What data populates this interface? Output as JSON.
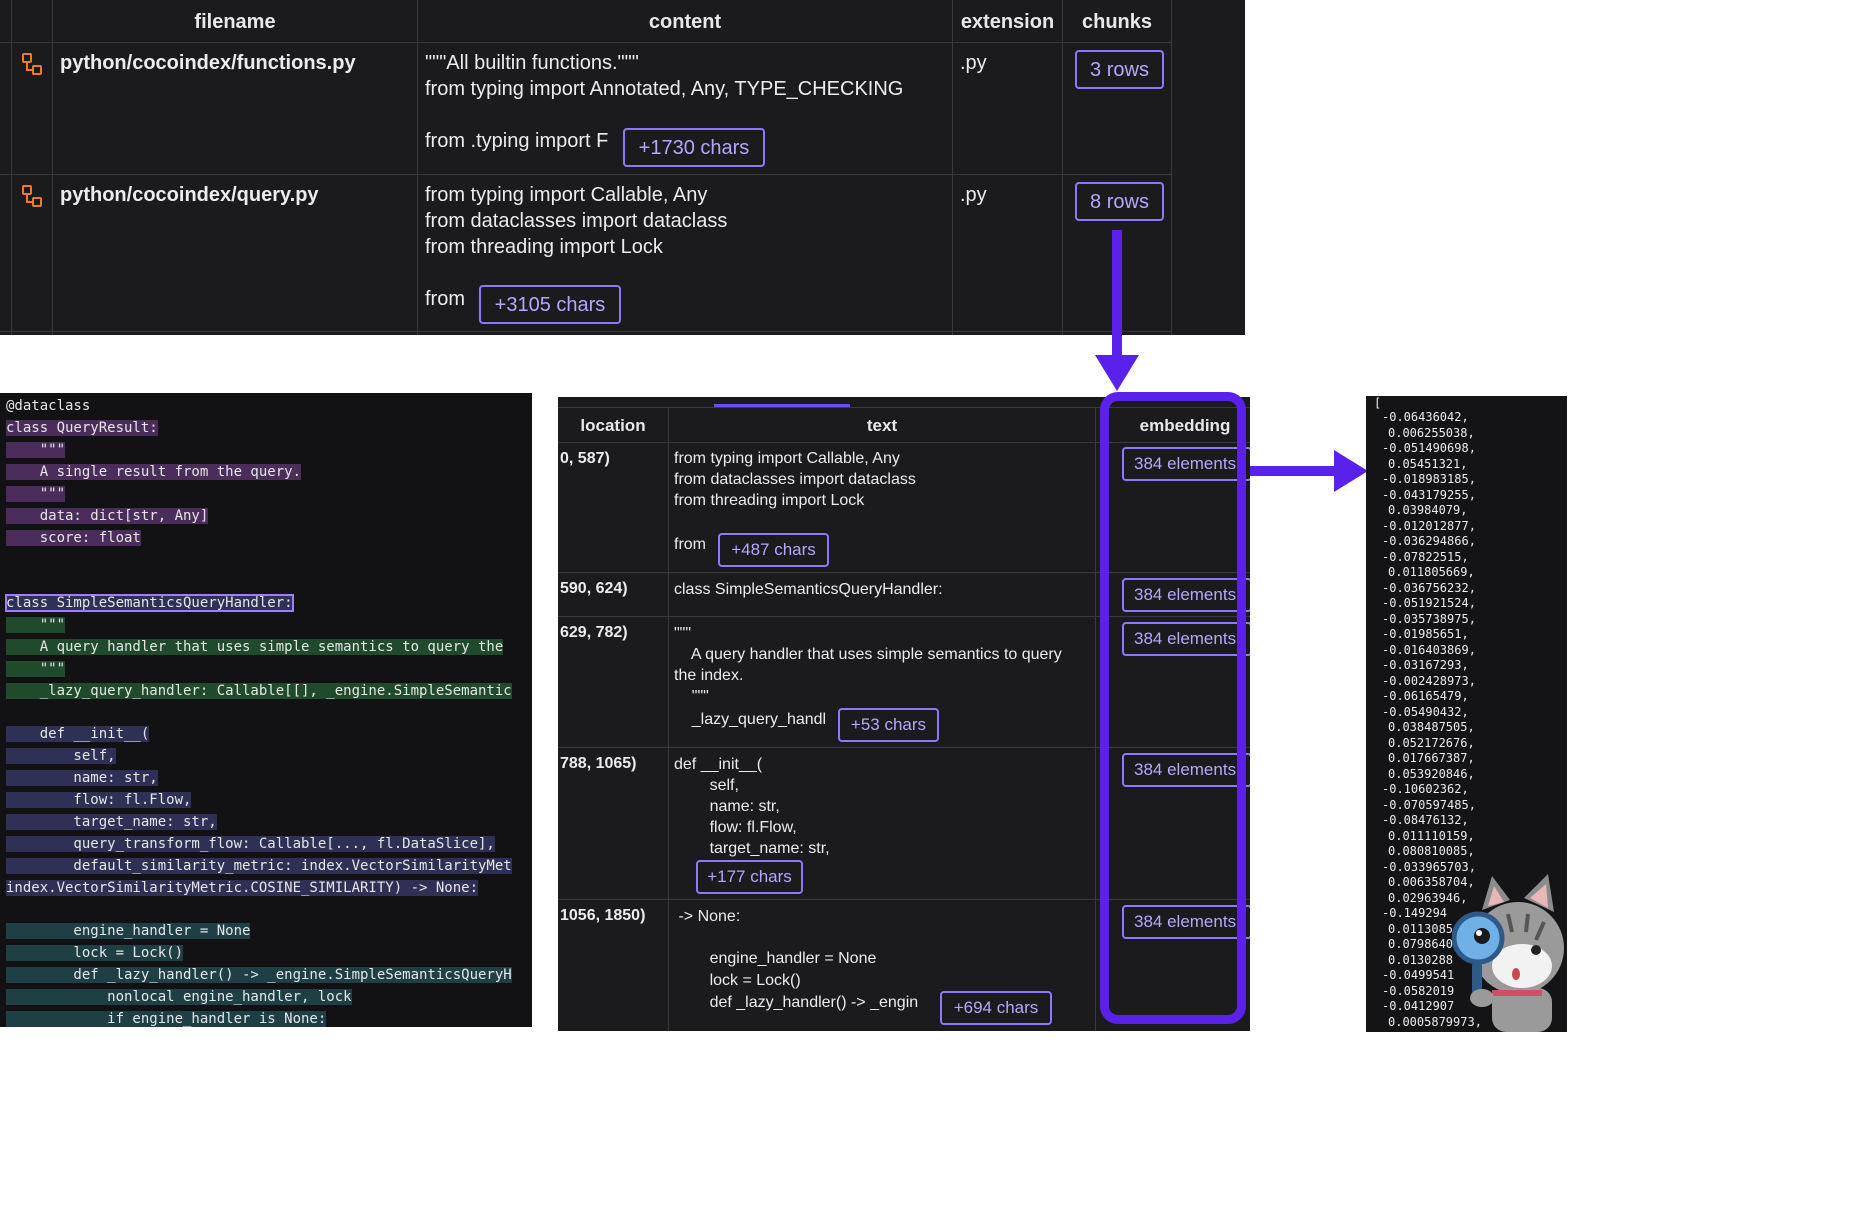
{
  "top_table": {
    "headers": [
      "filename",
      "content",
      "extension",
      "chunks"
    ],
    "rows": [
      {
        "filename": "python/cocoindex/functions.py",
        "content_lines": [
          "\"\"\"All builtin functions.\"\"\"",
          "from typing import Annotated, Any, TYPE_CHECKING",
          "",
          "from .typing import F"
        ],
        "more": "+1730 chars",
        "extension": ".py",
        "chunks": "3 rows"
      },
      {
        "filename": "python/cocoindex/query.py",
        "content_lines": [
          "from typing import Callable, Any",
          "from dataclasses import dataclass",
          "from threading import Lock",
          "",
          "from"
        ],
        "more": "+3105 chars",
        "extension": ".py",
        "chunks": "8 rows"
      }
    ]
  },
  "code_panel": {
    "lines": [
      "@dataclass",
      "class QueryResult:",
      "    \"\"\"",
      "    A single result from the query.",
      "    \"\"\"",
      "    data: dict[str, Any]",
      "    score: float",
      "",
      "",
      "class SimpleSemanticsQueryHandler:",
      "    \"\"\"",
      "    A query handler that uses simple semantics to query the",
      "    \"\"\"",
      "    _lazy_query_handler: Callable[[], _engine.SimpleSemantic",
      "",
      "    def __init__(",
      "        self,",
      "        name: str,",
      "        flow: fl.Flow,",
      "        target_name: str,",
      "        query_transform_flow: Callable[..., fl.DataSlice],",
      "        default_similarity_metric: index.VectorSimilarityMet",
      "index.VectorSimilarityMetric.COSINE_SIMILARITY) -> None:",
      "",
      "        engine_handler = None",
      "        lock = Lock()",
      "        def _lazy_handler() -> _engine.SimpleSemanticsQueryH",
      "            nonlocal engine_handler, lock",
      "            if engine_handler is None:"
    ]
  },
  "chunk_table": {
    "headers": [
      "location",
      "text",
      "embedding"
    ],
    "rows": [
      {
        "location": "0, 587)",
        "text_lines": [
          "from typing import Callable, Any",
          "from dataclasses import dataclass",
          "from threading import Lock",
          "",
          "from"
        ],
        "more": "+487 chars",
        "embedding": "384 elements"
      },
      {
        "location": "590, 624)",
        "text_lines": [
          "class SimpleSemanticsQueryHandler:"
        ],
        "more": "",
        "embedding": "384 elements"
      },
      {
        "location": "629, 782)",
        "text_lines": [
          "\"\"\"",
          "    A query handler that uses simple semantics to query",
          "the index.",
          "    \"\"\"",
          "    _lazy_query_handl"
        ],
        "more": "+53 chars",
        "embedding": "384 elements"
      },
      {
        "location": "788, 1065)",
        "text_lines": [
          "def __init__(",
          "        self,",
          "        name: str,",
          "        flow: fl.Flow,",
          "        target_name: str,"
        ],
        "more": "+177 chars",
        "embedding": "384 elements"
      },
      {
        "location": "1056, 1850)",
        "text_lines": [
          " -> None:",
          "",
          "        engine_handler = None",
          "        lock = Lock()",
          "        def _lazy_handler() -> _engin"
        ],
        "more": "+694 chars",
        "embedding": "384 elements"
      }
    ]
  },
  "vector_panel": {
    "open_bracket": "[",
    "values": [
      "-0.06436042,",
      "0.006255038,",
      "-0.051490698,",
      "0.05451321,",
      "-0.018983185,",
      "-0.043179255,",
      "0.03984079,",
      "-0.012012877,",
      "-0.036294866,",
      "-0.07822515,",
      "0.011805669,",
      "-0.036756232,",
      "-0.051921524,",
      "-0.035738975,",
      "-0.01985651,",
      "-0.016403869,",
      "-0.03167293,",
      "-0.002428973,",
      "-0.06165479,",
      "-0.05490432,",
      "0.038487505,",
      "0.052172676,",
      "0.017667387,",
      "0.053920846,",
      "-0.10602362,",
      "-0.070597485,",
      "-0.08476132,",
      "0.011110159,",
      "0.080810085,",
      "-0.033965703,",
      "0.006358704,",
      "0.02963946,",
      "-0.149294",
      "0.0113085",
      "0.0798640",
      "0.0130288",
      "-0.0499541",
      "-0.0582019",
      "-0.0412907",
      "0.0005879973,"
    ]
  },
  "colors": {
    "accent": "#5a21ea",
    "chip_border": "#8e78ff",
    "panel_bg": "#1b1b1d"
  }
}
